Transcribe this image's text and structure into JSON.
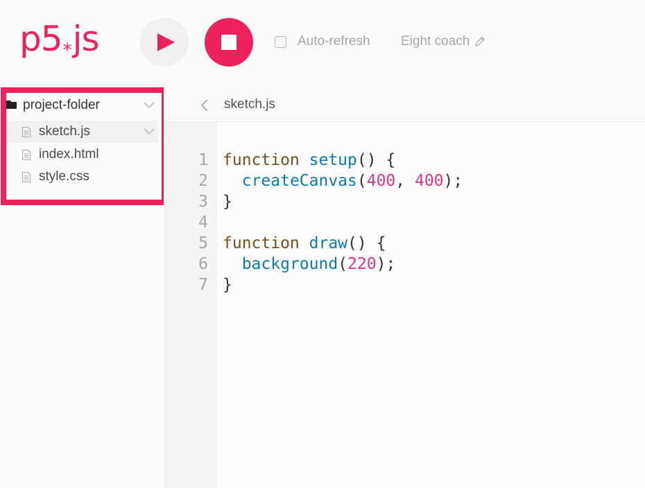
{
  "header": {
    "logo_main": "p5",
    "logo_asterisk": "*",
    "logo_suffix": "js",
    "play_icon": "play-icon",
    "stop_icon": "stop-icon",
    "autorefresh_label": "Auto-refresh",
    "autorefresh_checked": false,
    "project_name": "Eight coach",
    "edit_icon": "pencil-icon"
  },
  "sidebar": {
    "folder_icon": "folder-icon",
    "folder_name": "project-folder",
    "files": [
      {
        "name": "sketch.js",
        "icon": "file-icon",
        "active": true
      },
      {
        "name": "index.html",
        "icon": "file-icon",
        "active": false
      },
      {
        "name": "style.css",
        "icon": "file-icon",
        "active": false
      }
    ]
  },
  "editor": {
    "tab_title": "sketch.js",
    "line_numbers": [
      "1",
      "2",
      "3",
      "4",
      "5",
      "6",
      "7"
    ],
    "lines": [
      [
        {
          "t": "function",
          "c": "kw"
        },
        {
          "t": " ",
          "c": ""
        },
        {
          "t": "setup",
          "c": "fn"
        },
        {
          "t": "() {",
          "c": ""
        }
      ],
      [
        {
          "t": "  ",
          "c": ""
        },
        {
          "t": "createCanvas",
          "c": "fn"
        },
        {
          "t": "(",
          "c": ""
        },
        {
          "t": "400",
          "c": "num"
        },
        {
          "t": ", ",
          "c": ""
        },
        {
          "t": "400",
          "c": "num"
        },
        {
          "t": ");",
          "c": ""
        }
      ],
      [
        {
          "t": "}",
          "c": ""
        }
      ],
      [],
      [
        {
          "t": "function",
          "c": "kw"
        },
        {
          "t": " ",
          "c": ""
        },
        {
          "t": "draw",
          "c": "fn"
        },
        {
          "t": "() {",
          "c": ""
        }
      ],
      [
        {
          "t": "  ",
          "c": ""
        },
        {
          "t": "background",
          "c": "fn"
        },
        {
          "t": "(",
          "c": ""
        },
        {
          "t": "220",
          "c": "num"
        },
        {
          "t": ");",
          "c": ""
        }
      ],
      [
        {
          "t": "}",
          "c": ""
        }
      ]
    ]
  },
  "colors": {
    "accent": "#ed225d",
    "keyword": "#704f21",
    "function": "#0b7ca9",
    "number": "#dc3787"
  }
}
